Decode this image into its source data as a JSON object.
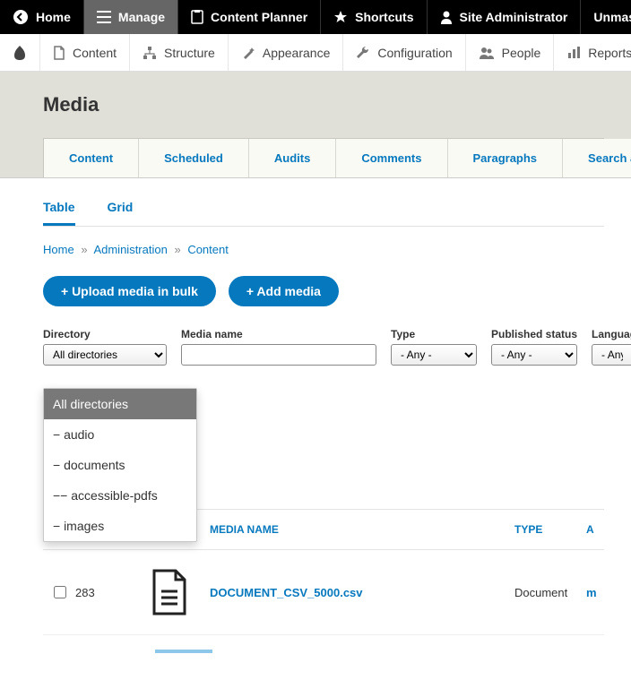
{
  "topbar": {
    "home": "Home",
    "manage": "Manage",
    "content_planner": "Content Planner",
    "shortcuts": "Shortcuts",
    "site_admin": "Site Administrator",
    "unmasq": "Unmasquera"
  },
  "subbar": {
    "content": "Content",
    "structure": "Structure",
    "appearance": "Appearance",
    "configuration": "Configuration",
    "people": "People",
    "reports": "Reports"
  },
  "page": {
    "title": "Media"
  },
  "primary_tabs": {
    "content": "Content",
    "scheduled": "Scheduled",
    "audits": "Audits",
    "comments": "Comments",
    "paragraphs": "Paragraphs",
    "sar": "Search and Replace Scanner"
  },
  "secondary_tabs": {
    "table": "Table",
    "grid": "Grid"
  },
  "breadcrumb": {
    "home": "Home",
    "admin": "Administration",
    "content": "Content"
  },
  "actions": {
    "upload": "+ Upload media in bulk",
    "add": "+ Add media"
  },
  "filters": {
    "directory_label": "Directory",
    "directory_value": "All directories",
    "medianame_label": "Media name",
    "medianame_value": "",
    "type_label": "Type",
    "type_value": "- Any -",
    "published_label": "Published status",
    "published_value": "- Any -",
    "language_label": "Language",
    "language_value": "- Any -"
  },
  "directory_options": {
    "o0": "All directories",
    "o1": "− audio",
    "o2": "− documents",
    "o3": "−− accessible-pdfs",
    "o4": "− images"
  },
  "table": {
    "head_name": "MEDIA NAME",
    "head_type": "TYPE",
    "head_ext": "A",
    "row1_id": "283",
    "row1_name": "DOCUMENT_CSV_5000.csv",
    "row1_type": "Document",
    "row1_ext": "m"
  }
}
